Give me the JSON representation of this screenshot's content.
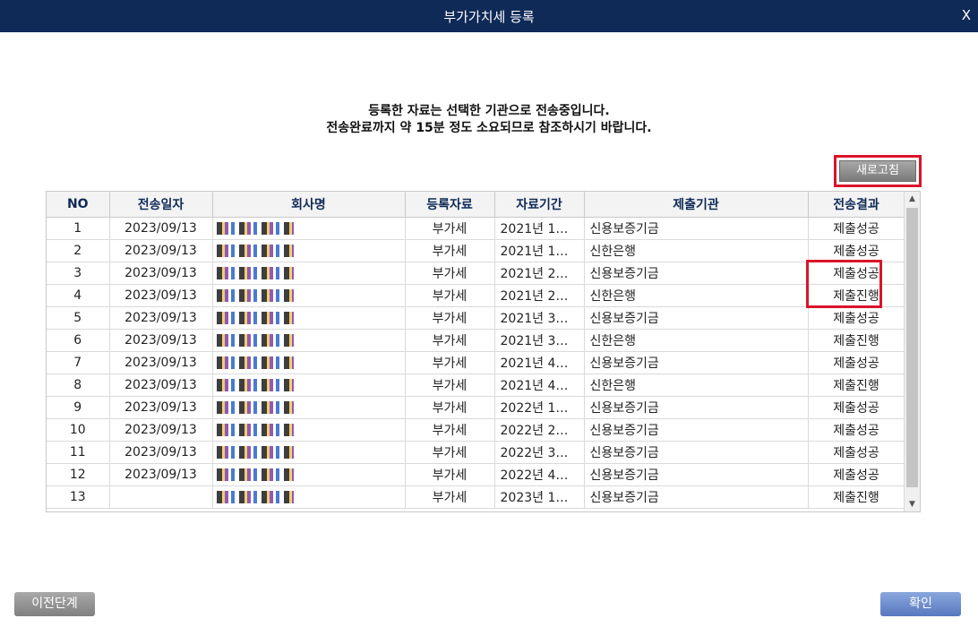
{
  "window": {
    "title": "부가가치세 등록",
    "close_label": "X"
  },
  "message": {
    "line1": "등록한 자료는 선택한 기관으로 전송중입니다.",
    "line2": "전송완료까지 약 15분 정도 소요되므로 참조하시기 바랍니다."
  },
  "refresh_label": "새로고침",
  "table": {
    "headers": [
      "NO",
      "전송일자",
      "회사명",
      "등록자료",
      "자료기간",
      "제출기관",
      "전송결과"
    ],
    "rows": [
      {
        "no": "1",
        "date": "2023/09/13",
        "data": "부가세",
        "period": "2021년 1…",
        "org": "신용보증기금",
        "result": "제출성공"
      },
      {
        "no": "2",
        "date": "2023/09/13",
        "data": "부가세",
        "period": "2021년 1…",
        "org": "신한은행",
        "result": "제출성공"
      },
      {
        "no": "3",
        "date": "2023/09/13",
        "data": "부가세",
        "period": "2021년 2…",
        "org": "신용보증기금",
        "result": "제출성공"
      },
      {
        "no": "4",
        "date": "2023/09/13",
        "data": "부가세",
        "period": "2021년 2…",
        "org": "신한은행",
        "result": "제출진행"
      },
      {
        "no": "5",
        "date": "2023/09/13",
        "data": "부가세",
        "period": "2021년 3…",
        "org": "신용보증기금",
        "result": "제출성공"
      },
      {
        "no": "6",
        "date": "2023/09/13",
        "data": "부가세",
        "period": "2021년 3…",
        "org": "신한은행",
        "result": "제출진행"
      },
      {
        "no": "7",
        "date": "2023/09/13",
        "data": "부가세",
        "period": "2021년 4…",
        "org": "신용보증기금",
        "result": "제출성공"
      },
      {
        "no": "8",
        "date": "2023/09/13",
        "data": "부가세",
        "period": "2021년 4…",
        "org": "신한은행",
        "result": "제출진행"
      },
      {
        "no": "9",
        "date": "2023/09/13",
        "data": "부가세",
        "period": "2022년 1…",
        "org": "신용보증기금",
        "result": "제출성공"
      },
      {
        "no": "10",
        "date": "2023/09/13",
        "data": "부가세",
        "period": "2022년 2…",
        "org": "신용보증기금",
        "result": "제출성공"
      },
      {
        "no": "11",
        "date": "2023/09/13",
        "data": "부가세",
        "period": "2022년 3…",
        "org": "신용보증기금",
        "result": "제출성공"
      },
      {
        "no": "12",
        "date": "2023/09/13",
        "data": "부가세",
        "period": "2022년 4…",
        "org": "신용보증기금",
        "result": "제출성공"
      },
      {
        "no": "13",
        "date": "",
        "data": "부가세",
        "period": "2023년 1…",
        "org": "신용보증기금",
        "result": "제출진행"
      }
    ]
  },
  "footer": {
    "prev_label": "이전단계",
    "ok_label": "확인"
  },
  "colors": {
    "titlebar": "#0f2a57",
    "highlight": "#d9142a",
    "header_text": "#0f2a57"
  }
}
